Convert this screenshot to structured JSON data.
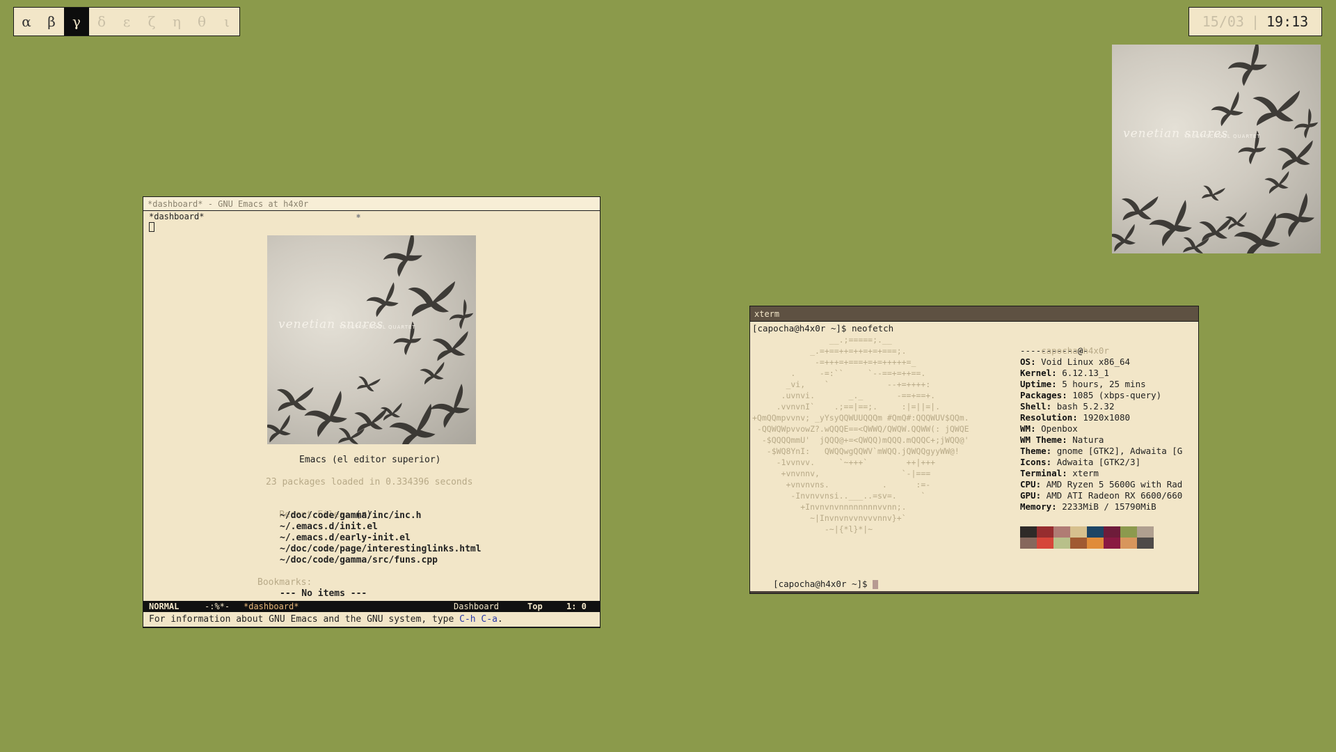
{
  "workspaces": [
    {
      "label": "α",
      "state": "occupied"
    },
    {
      "label": "β",
      "state": "occupied"
    },
    {
      "label": "γ",
      "state": "active"
    },
    {
      "label": "δ",
      "state": "empty"
    },
    {
      "label": "ε",
      "state": "empty"
    },
    {
      "label": "ζ",
      "state": "empty"
    },
    {
      "label": "η",
      "state": "empty"
    },
    {
      "label": "θ",
      "state": "empty"
    },
    {
      "label": "ι",
      "state": "empty"
    }
  ],
  "clock": {
    "date": "15/03",
    "separator": "|",
    "time": "19:13"
  },
  "album_art": {
    "title": "venetian snares",
    "subtitle": "TRUST SCHOOL QUARTET"
  },
  "emacs": {
    "window_title": "*dashboard* - GNU Emacs at h4x0r",
    "tab_label": "*dashboard*",
    "tab_star": "✱",
    "banner_title": "Emacs (el editor superior)",
    "packages_line": "23 packages loaded in 0.334396 seconds",
    "recent_header": "Recent Files:",
    "recent_key": "(r)",
    "recent_files": [
      "~/doc/code/gamma/inc/inc.h",
      "~/.emacs.d/init.el",
      "~/.emacs.d/early-init.el",
      "~/doc/code/page/interestinglinks.html",
      "~/doc/code/gamma/src/funs.cpp"
    ],
    "bookmarks_header": "Bookmarks:",
    "bookmarks_empty": "--- No items ---",
    "modeline": {
      "mode": "NORMAL",
      "flags": "-:%*-",
      "buffer": "*dashboard*",
      "major_mode": "Dashboard",
      "position": "Top",
      "line_col": "1:  0"
    },
    "minibuffer": {
      "text": "For information about GNU Emacs and the GNU system, type ",
      "keys": "C-h C-a",
      "end": "."
    }
  },
  "xterm": {
    "window_title": "xterm",
    "command_line": "[capocha@h4x0r ~]$ neofetch",
    "prompt": "[capocha@h4x0r ~]$ ",
    "user": "capocha",
    "at": "@",
    "host": "h4x0r",
    "rule": "-------------",
    "info": [
      {
        "key": "OS",
        "value": " Void Linux x86_64"
      },
      {
        "key": "Kernel",
        "value": " 6.12.13_1"
      },
      {
        "key": "Uptime",
        "value": " 5 hours, 25 mins"
      },
      {
        "key": "Packages",
        "value": " 1085 (xbps-query)"
      },
      {
        "key": "Shell",
        "value": " bash 5.2.32"
      },
      {
        "key": "Resolution",
        "value": " 1920x1080"
      },
      {
        "key": "WM",
        "value": " Openbox"
      },
      {
        "key": "WM Theme",
        "value": " Natura"
      },
      {
        "key": "Theme",
        "value": " gnome [GTK2], Adwaita [G"
      },
      {
        "key": "Icons",
        "value": " Adwaita [GTK2/3]"
      },
      {
        "key": "Terminal",
        "value": " xterm"
      },
      {
        "key": "CPU",
        "value": " AMD Ryzen 5 5600G with Rad"
      },
      {
        "key": "GPU",
        "value": " AMD ATI Radeon RX 6600/660"
      },
      {
        "key": "Memory",
        "value": " 2233MiB / 15790MiB"
      }
    ],
    "ascii_art": [
      "                __.;=====;.__",
      "            _.=+==++=++=+=+===;.",
      "             -=+++=+===+=+=+++++=_",
      "        .     -=:``     `--==+=++==.",
      "       _vi,    `            --+=++++:",
      "      .uvnvi.       _._       -==+==+.",
      "     .vvnvnI`    .;==|==;.     :|=||=|.",
      "+QmQQmpvvnv; _yYsyQQWUUQQQm #QmQ#:QQQWUV$QQm.",
      " -QQWQWpvvowZ?.wQQQE==<QWWQ/QWQW.QQWW(: jQWQE",
      "  -$QQQQmmU'  jQQQ@+=<QWQQ)mQQQ.mQQQC+;jWQQ@'",
      "   -$WQ8YnI:   QWQQwgQQWV`mWQQ.jQWQQgyyWW@!",
      "     -1vvnvv.     `~+++`        ++|+++",
      "      +vnvnnv,                 `-|===",
      "       +vnvnvns.           .      :=-",
      "        -Invnvvnsi..___..=sv=.     `",
      "          +Invnvnvnnnnnnnnvvnn;.",
      "            ~|Invnvnvvnvvvnnv}+`",
      "               -~|{*l}*|~"
    ],
    "palette_top": [
      "#2e2a28",
      "#962d2f",
      "#b07c74",
      "#d6c08e",
      "#1d4565",
      "#6e1c3a",
      "#8c9a4e",
      "#b0a090"
    ],
    "palette_bottom": [
      "#86675c",
      "#d6463a",
      "#b8c08a",
      "#a05a32",
      "#e08c3a",
      "#8a1a42",
      "#d8965c",
      "#4e4a48"
    ]
  }
}
